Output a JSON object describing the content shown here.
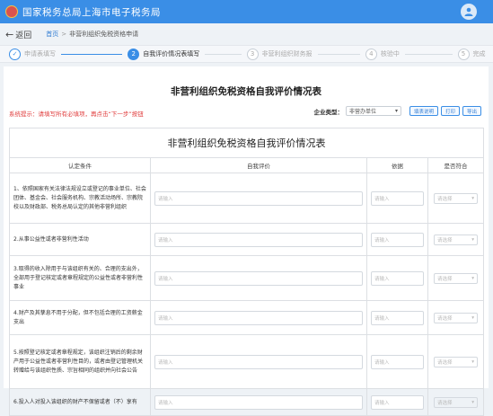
{
  "header": {
    "title": "国家税务总局上海市电子税务局"
  },
  "nav": {
    "back_label": "返回",
    "breadcrumb": {
      "home": "首页",
      "sep": ">",
      "current": "非营利组织免税资格申请"
    }
  },
  "steps": [
    {
      "num": "✓",
      "label": "申请表填写",
      "state": "done"
    },
    {
      "num": "2",
      "label": "自我评价情况表填写",
      "state": "active"
    },
    {
      "num": "3",
      "label": "非营利组织财务报",
      "state": "todo"
    },
    {
      "num": "4",
      "label": "核验中",
      "state": "todo"
    },
    {
      "num": "5",
      "label": "完成",
      "state": "todo"
    }
  ],
  "page": {
    "title": "非营利组织免税资格自我评价情况表",
    "hint": "系统提示：请填写所有必填项，再点击“下一步”按钮",
    "enterprise_type_label": "企业类型：",
    "enterprise_type_value": "非营办单位",
    "buttons": [
      "填表说明",
      "打印",
      "导出"
    ]
  },
  "table": {
    "title": "非营利组织免税资格自我评价情况表",
    "headers": [
      "认定条件",
      "自我评价",
      "依据",
      "是否符合"
    ],
    "input_placeholder": "请输入",
    "select_placeholder": "请选择",
    "rows": [
      "1、依照国家有关法律法规设立或登记的事业单位、社会团体、基金会、社会服务机构、宗教活动场所、宗教院校以及财政部、税务总局认定的其他非营利组织",
      "2.从事公益性或者非营利性活动",
      "3.取得的收入除用于与该组织有关的、合理的支出外，全部用于登记核定或者章程规定的公益性或者非营利性事业",
      "4.财产及其孳息不用于分配，但不包括合理的工资薪金支出",
      "5.按照登记核定或者章程规定，该组织注销后的剩余财产用于公益性或者非营利性目的，或者由登记管理机关转赠给与该组织性质、宗旨相同的组织并向社会公告",
      "6.投入人对投入该组织的财产不保留或者（不）享有"
    ]
  },
  "colors": {
    "primary": "#3a8ee6",
    "hint": "#e03c3c"
  }
}
